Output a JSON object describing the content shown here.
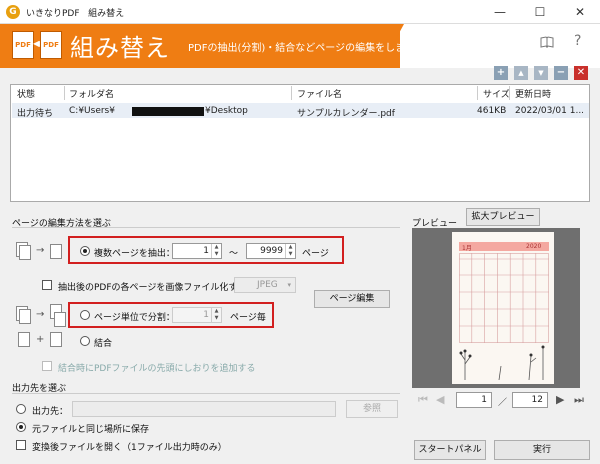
{
  "window": {
    "app_name": "いきなりPDF",
    "title": "組み替え",
    "logo_letter": "G",
    "minimize": "—",
    "maximize": "☐",
    "close": "✕"
  },
  "header": {
    "title": "組み替え",
    "subtitle": "PDFの抽出(分割)・結合などページの編集をします",
    "pdf_left": "PDF",
    "pdf_right": "PDF",
    "help_icon": "?"
  },
  "toolbar": {
    "add": "+",
    "up": "▲",
    "down": "▼",
    "remove": "−",
    "delete": "✕"
  },
  "file_table": {
    "columns": [
      "状態",
      "フォルダ名",
      "ファイル名",
      "サイズ",
      "更新日時"
    ],
    "rows": [
      {
        "status": "出力待ち",
        "folder_prefix": "C:¥Users¥",
        "folder_suffix": "¥Desktop",
        "file": "サンプルカレンダー.pdf",
        "size": "461KB",
        "updated": "2022/03/01 1..."
      }
    ]
  },
  "edit_section": {
    "label": "ページの編集方法を選ぶ",
    "extract_label": "複数ページを抽出：",
    "from_value": "1",
    "tilde": "～",
    "to_value": "9999",
    "page_suffix": "ページ",
    "image_check_label": "抽出後のPDFの各ページを画像ファイル化する",
    "image_format": "JPEG",
    "page_edit_button": "ページ編集",
    "split_label": "ページ単位で分割：",
    "split_value": "1",
    "split_suffix": "ページ毎",
    "merge_label": "結合",
    "bookmark_label": "結合時にPDFファイルの先頭にしおりを追加する"
  },
  "output_section": {
    "label": "出力先を選ぶ",
    "dest_label": "出力先：",
    "browse_button": "参照",
    "same_location_label": "元ファイルと同じ場所に保存",
    "open_after_label": "変換後ファイルを開く（1ファイル出力時のみ）"
  },
  "preview": {
    "label": "プレビュー",
    "zoom_button": "拡大プレビュー",
    "cal_month": "1月",
    "cal_year": "2020",
    "current_page": "1",
    "separator": "／",
    "total_pages": "12"
  },
  "footer": {
    "start_panel": "スタートパネル",
    "execute": "実行"
  },
  "colors": {
    "accent": "#ef7d13",
    "highlight": "#d21f1f"
  }
}
